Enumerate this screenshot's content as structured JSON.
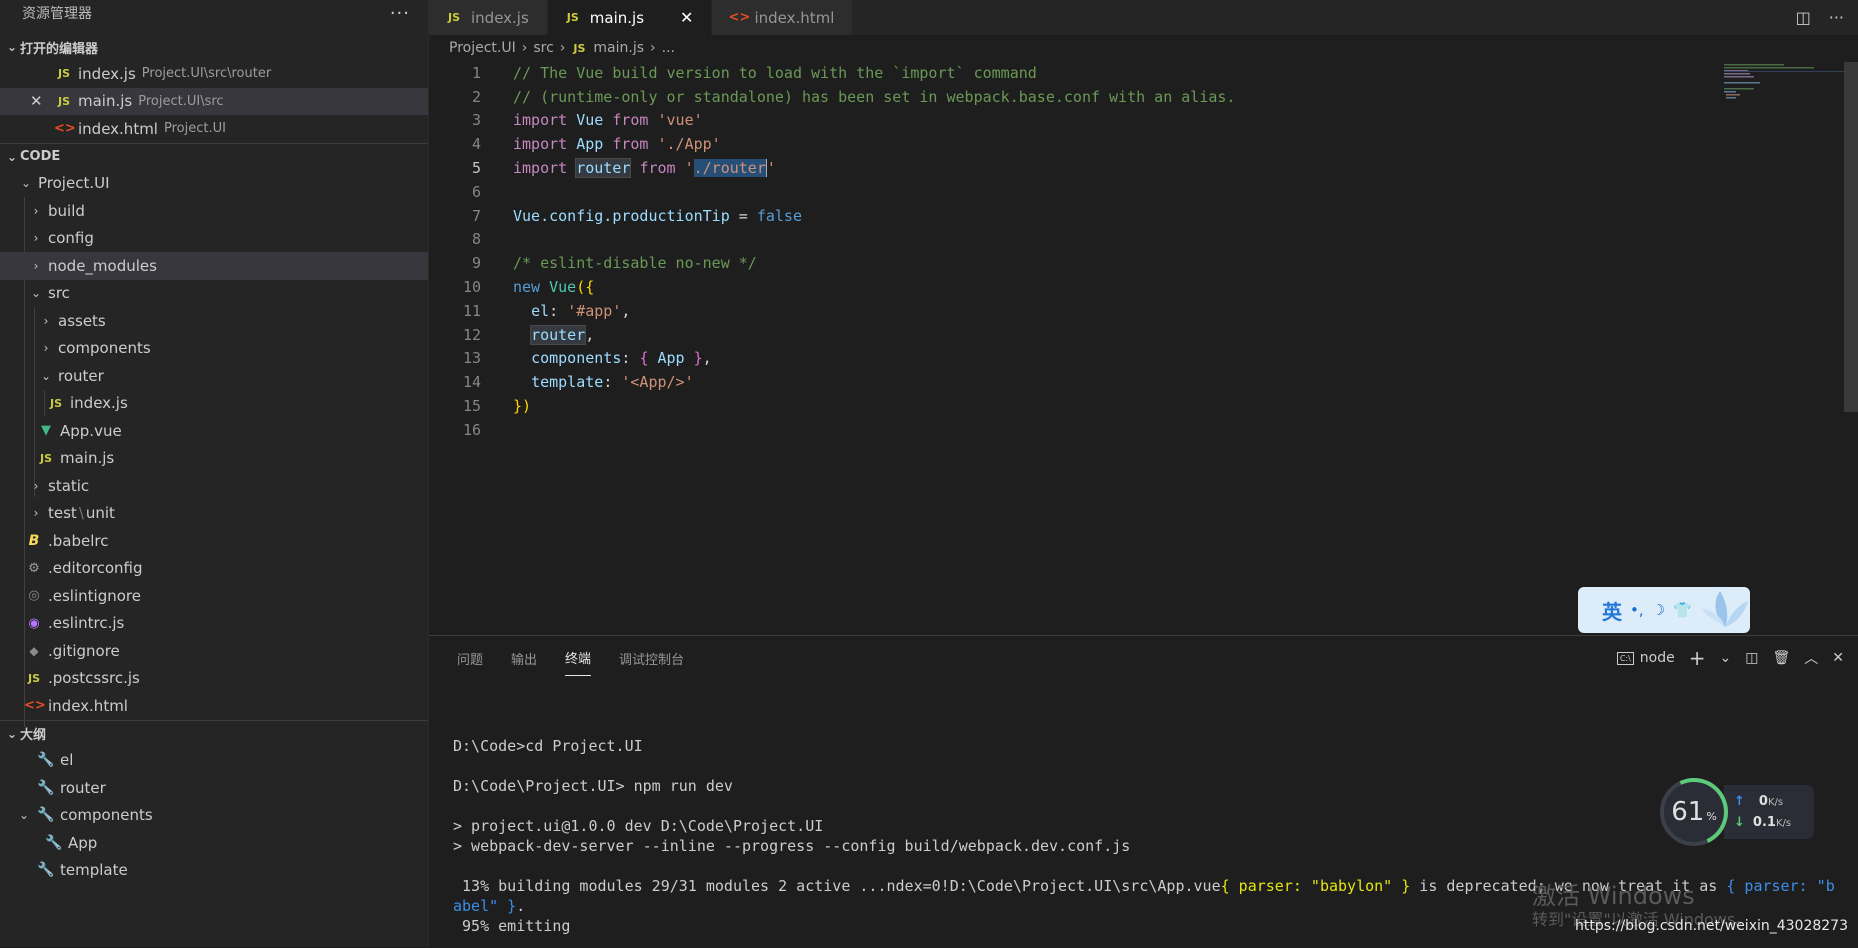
{
  "sidebar": {
    "title": "资源管理器",
    "more": "···",
    "open_editors": {
      "header": "打开的编辑器",
      "items": [
        {
          "icon": "JS",
          "name": "index.js",
          "desc": "Project.UI\\src\\router"
        },
        {
          "icon": "JS",
          "name": "main.js",
          "desc": "Project.UI\\src",
          "close": "✕"
        },
        {
          "icon": "<>",
          "name": "index.html",
          "desc": "Project.UI"
        }
      ]
    },
    "code": {
      "header": "CODE",
      "tree": [
        {
          "name": "Project.UI",
          "chev": "⌄"
        },
        {
          "name": "build",
          "chev": "›"
        },
        {
          "name": "config",
          "chev": "›"
        },
        {
          "name": "node_modules",
          "chev": "›"
        },
        {
          "name": "src",
          "chev": "⌄"
        },
        {
          "name": "assets",
          "chev": "›"
        },
        {
          "name": "components",
          "chev": "›"
        },
        {
          "name": "router",
          "chev": "⌄"
        },
        {
          "name": "index.js",
          "icon": "JS"
        },
        {
          "name": "App.vue",
          "icon": "▼"
        },
        {
          "name": "main.js",
          "icon": "JS"
        },
        {
          "name": "static",
          "chev": "›"
        },
        {
          "name": "test",
          "name2": "unit",
          "chev": "›",
          "sep": "\\"
        },
        {
          "name": ".babelrc",
          "icon": "B"
        },
        {
          "name": ".editorconfig",
          "icon": "⚙"
        },
        {
          "name": ".eslintignore",
          "icon": "◎"
        },
        {
          "name": ".eslintrc.js",
          "icon": "◉"
        },
        {
          "name": ".gitignore",
          "icon": "◆"
        },
        {
          "name": ".postcssrc.js",
          "icon": "JS"
        },
        {
          "name": "index.html",
          "icon": "<>"
        }
      ]
    },
    "outline": {
      "header": "大纲",
      "items": [
        {
          "name": "el",
          "icon": "🔧"
        },
        {
          "name": "router",
          "icon": "🔧"
        },
        {
          "name": "components",
          "icon": "🔧",
          "chev": "⌄"
        },
        {
          "name": "App",
          "icon": "🔧"
        },
        {
          "name": "template",
          "icon": "🔧"
        }
      ]
    },
    "chev_open": "⌄"
  },
  "tabs": [
    {
      "icon": "JS",
      "label": "index.js"
    },
    {
      "icon": "JS",
      "label": "main.js",
      "close": "✕"
    },
    {
      "icon": "<>",
      "label": "index.html"
    }
  ],
  "tab_actions": {
    "split": "◫",
    "more": "···"
  },
  "breadcrumb": [
    "Project.UI",
    "src",
    "main.js",
    "..."
  ],
  "breadcrumb_sep": "›",
  "breadcrumb_icon": "JS",
  "code_lines": [
    "1",
    "2",
    "3",
    "4",
    "5",
    "6",
    "7",
    "8",
    "9",
    "10",
    "11",
    "12",
    "13",
    "14",
    "15",
    "16"
  ],
  "code_tokens": {
    "l1": "// The Vue build version to load with the `import` command",
    "l2": "// (runtime-only or standalone) has been set in webpack.base.conf with an alias.",
    "import": "import",
    "from": "from",
    "Vue": "Vue",
    "App": "App",
    "router": "router",
    "s_vue": "'vue'",
    "s_app": "'./App'",
    "q": "'",
    "s_router": "./router",
    "config": ".config.productionTip",
    "eq": " = ",
    "false": "false",
    "l9": "/* eslint-disable no-new */",
    "new": "new",
    "open": "({",
    "el": "el",
    "colon": ": ",
    "s_el": "'#app'",
    "comma": ",",
    "components": "components",
    "lb": "{ ",
    "rb": " }",
    "template": "template",
    "s_tpl": "'<App/>'",
    "close": "})"
  },
  "ime": {
    "lang": "英",
    "sym1": "•,",
    "sym2": "☽",
    "sym3": "👕"
  },
  "panel": {
    "tabs": [
      "问题",
      "输出",
      "终端",
      "调试控制台"
    ],
    "active": "终端",
    "terminal_name": "node",
    "terminal_icon": "C:\\",
    "actions": {
      "add": "+",
      "dropdown": "⌄",
      "split": "◫",
      "trash": "🗑",
      "max": "︿",
      "close": "✕"
    }
  },
  "terminal": {
    "l1": "D:\\Code>cd Project.UI",
    "l2": "D:\\Code\\Project.UI> npm run dev",
    "l3": "> project.ui@1.0.0 dev D:\\Code\\Project.UI",
    "l4": "> webpack-dev-server --inline --progress --config build/webpack.dev.conf.js",
    "l5a": " 13% building modules 29/31 modules 2 active ...ndex=0!D:\\Code\\Project.UI\\src\\App.vue",
    "l5b": "{ parser: \"babylon\" }",
    "l5c": " is deprecated; we now treat it as ",
    "l5d": "{ parser: \"b",
    "l6a": "abel\" }",
    "l6b": ".",
    "l7": " 95% emitting"
  },
  "netspeed": {
    "percent": "61",
    "pct_sign": "%",
    "up": "0",
    "down": "0.1",
    "unit": "K/s",
    "up_arrow": "↑",
    "down_arrow": "↓"
  },
  "watermark": {
    "line1": "激活 Windows",
    "line2": "转到\"设置\"以激活 Windows。",
    "url": "https://blog.csdn.net/weixin_43028273"
  },
  "colors": {
    "accent": "#007acc",
    "js": "#cbcb41",
    "html": "#e44d26",
    "vue": "#41b883"
  }
}
